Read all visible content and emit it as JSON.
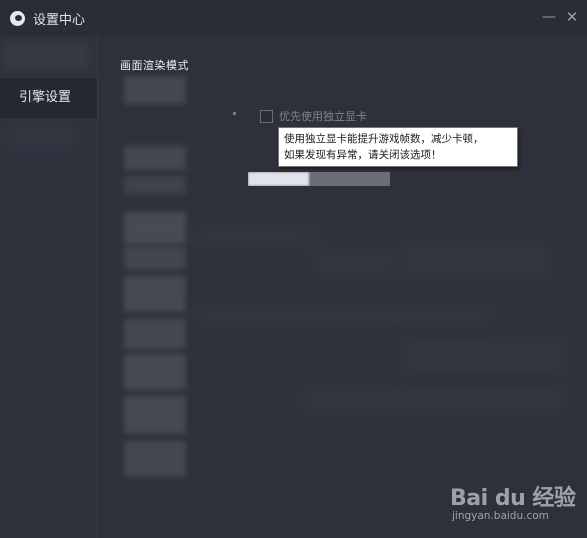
{
  "window": {
    "title": "设置中心",
    "minimize_glyph": "—",
    "close_glyph": "✕"
  },
  "sidebar": {
    "items": [
      {
        "label": "引擎设置",
        "selected": true
      }
    ]
  },
  "content": {
    "section_title": "画面渲染模式",
    "checkbox": {
      "label": "优先使用独立显卡",
      "checked": false
    },
    "tooltip": {
      "line1": "使用独立显卡能提升游戏帧数，减少卡顿，",
      "line2": "如果发现有异常，请关闭该选项！"
    },
    "slider": {
      "fill_fraction": 0.43
    }
  },
  "watermark": {
    "logo": "Bai du 经验",
    "url": "jingyan.baidu.com"
  },
  "colors": {
    "background": "#2e303b",
    "titlebar": "#2a2c36",
    "sidebar_selected": "#262831",
    "tooltip_bg": "#ffffff",
    "slider_fill": "#e2e3e8",
    "slider_track": "#6a6c77"
  },
  "icons": {
    "app_logo": "app-logo-icon",
    "minimize": "minimize-icon",
    "close": "close-icon",
    "watermark_paw": "paw-icon"
  }
}
